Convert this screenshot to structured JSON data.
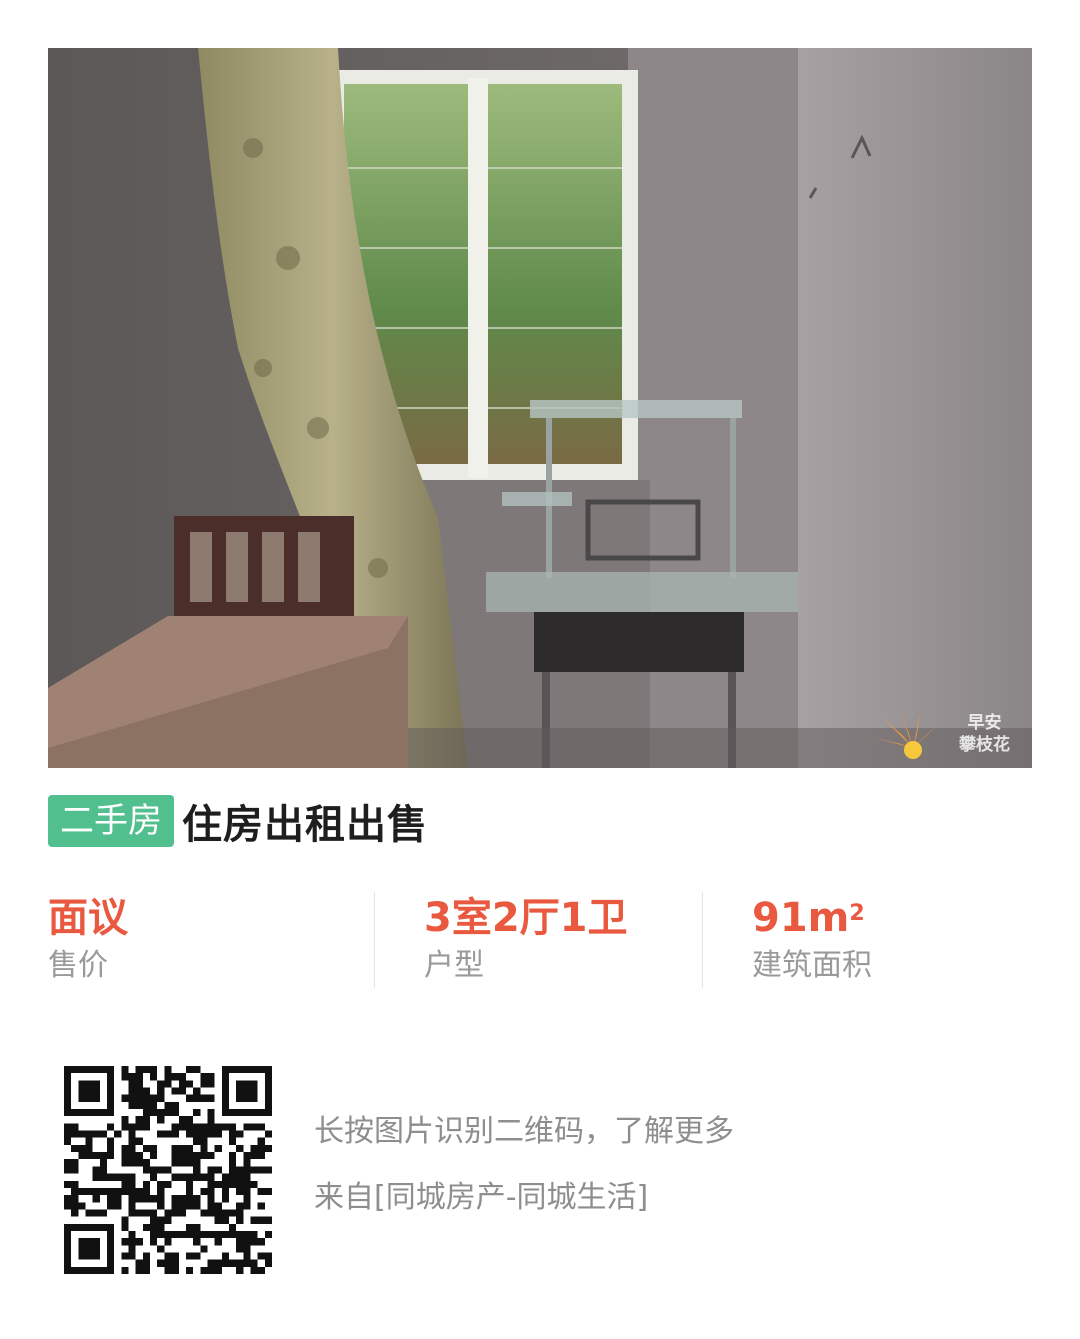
{
  "listing": {
    "category": "二手房",
    "title": "住房出租出售"
  },
  "stats": [
    {
      "value": "面议",
      "label": "售价"
    },
    {
      "value": "3室2厅1卫",
      "label": "户型"
    },
    {
      "value": "91m",
      "value_sup": "2",
      "label": "建筑面积"
    }
  ],
  "watermark": {
    "line1": "早安",
    "line2": "攀枝花"
  },
  "qr_section": {
    "hint": "长按图片识别二维码，了解更多",
    "source": "来自[同城房产-同城生活]"
  },
  "colors": {
    "badge_bg": "#52bf8e",
    "stat_value": "#e9593f",
    "label_gray": "#9a9a9a"
  },
  "icons": {
    "watermark_logo": "sunflower-logo-icon",
    "qr": "qr-code-icon"
  }
}
